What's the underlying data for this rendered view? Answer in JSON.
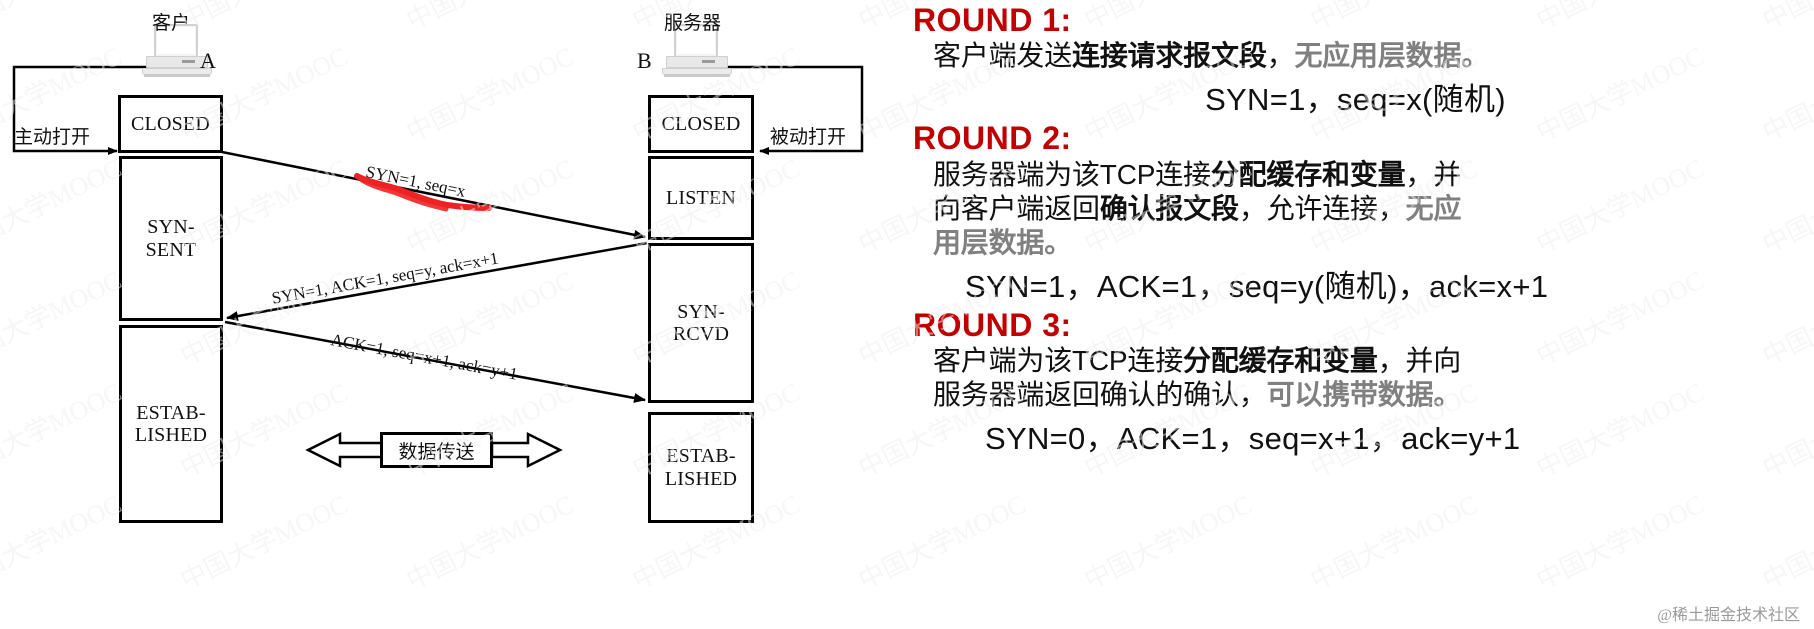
{
  "diagram": {
    "client": {
      "caption": "客户",
      "letter": "A",
      "open_label": "主动打开",
      "states": [
        "CLOSED",
        "SYN-\nSENT",
        "ESTAB-\nLISHED"
      ]
    },
    "server": {
      "caption": "服务器",
      "letter": "B",
      "open_label": "被动打开",
      "states": [
        "CLOSED",
        "LISTEN",
        "SYN-\nRCVD",
        "ESTAB-\nLISHED"
      ]
    },
    "messages": [
      "SYN=1, seq=x",
      "SYN=1, ACK=1, seq=y, ack=x+1",
      "ACK=1, seq=x+1, ack=y+1"
    ],
    "data_transfer": "数据传送",
    "highlight_color": "#ee2222"
  },
  "panel": {
    "rounds": [
      {
        "head": "ROUND 1:",
        "body": [
          {
            "runs": [
              {
                "t": "客户端发送",
                "s": "plain"
              },
              {
                "t": "连接请求报文段",
                "s": "bold"
              },
              {
                "t": "，",
                "s": "plain"
              },
              {
                "t": "无应用层数据",
                "s": "gray"
              },
              {
                "t": "。",
                "s": "gray"
              }
            ]
          }
        ],
        "formula": "SYN=1，seq=x(随机)",
        "formula_align": "center"
      },
      {
        "head": "ROUND 2:",
        "body": [
          {
            "runs": [
              {
                "t": "服务器端为该TCP连接",
                "s": "plain"
              },
              {
                "t": "分配缓存和变量",
                "s": "bold"
              },
              {
                "t": "，并",
                "s": "plain"
              }
            ]
          },
          {
            "runs": [
              {
                "t": "向客户端返回",
                "s": "plain"
              },
              {
                "t": "确认报文段",
                "s": "bold"
              },
              {
                "t": "，允许连接，",
                "s": "plain"
              },
              {
                "t": "无应",
                "s": "gray"
              }
            ]
          },
          {
            "runs": [
              {
                "t": "用层数据",
                "s": "gray"
              },
              {
                "t": "。",
                "s": "gray"
              }
            ]
          }
        ],
        "formula": "SYN=1，ACK=1，seq=y(随机)，ack=x+1",
        "formula_align": "wide"
      },
      {
        "head": "ROUND 3:",
        "body": [
          {
            "runs": [
              {
                "t": "客户端为该TCP连接",
                "s": "plain"
              },
              {
                "t": "分配缓存和变量",
                "s": "bold"
              },
              {
                "t": "，并向",
                "s": "plain"
              }
            ]
          },
          {
            "runs": [
              {
                "t": "服务器端返回确认的确认，",
                "s": "plain"
              },
              {
                "t": "可以携带数据",
                "s": "gray"
              },
              {
                "t": "。",
                "s": "gray"
              }
            ]
          }
        ],
        "formula": "SYN=0，ACK=1，seq=x+1，ack=y+1",
        "formula_align": "left-ind"
      }
    ],
    "accent_color": "#c00000",
    "credit": "@稀土掘金技术社区"
  },
  "watermark": {
    "text": "中国大学MOOC"
  }
}
